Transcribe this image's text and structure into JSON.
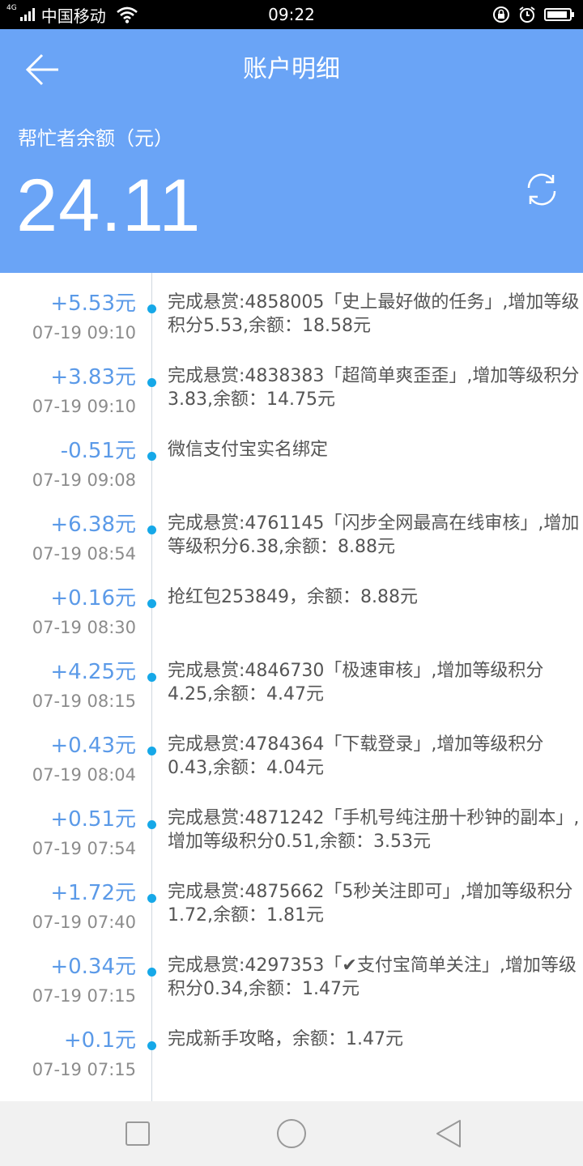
{
  "status_bar": {
    "network": "4G",
    "carrier": "中国移动",
    "time": "09:22",
    "icons": [
      "signal-icon",
      "wifi-icon",
      "rotation-lock-icon",
      "alarm-icon",
      "battery-icon"
    ]
  },
  "header": {
    "title": "账户明细",
    "balance_label": "帮忙者余额（元）",
    "balance": "24.11",
    "background_color": "#6aa4f6",
    "icons": [
      "back-arrow-icon",
      "refresh-icon"
    ]
  },
  "records": [
    {
      "amount": "+5.53元",
      "time": "07-19 09:10",
      "desc": "完成悬赏:4858005「史上最好做的任务」,增加等级积分5.53,余额：18.58元"
    },
    {
      "amount": "+3.83元",
      "time": "07-19 09:10",
      "desc": "完成悬赏:4838383「超简单爽歪歪」,增加等级积分3.83,余额：14.75元"
    },
    {
      "amount": "-0.51元",
      "time": "07-19 09:08",
      "desc": "微信支付宝实名绑定"
    },
    {
      "amount": "+6.38元",
      "time": "07-19 08:54",
      "desc": "完成悬赏:4761145「闪步全网最高在线审核」,增加等级积分6.38,余额：8.88元"
    },
    {
      "amount": "+0.16元",
      "time": "07-19 08:30",
      "desc": "抢红包253849，余额：8.88元"
    },
    {
      "amount": "+4.25元",
      "time": "07-19 08:15",
      "desc": "完成悬赏:4846730「极速审核」,增加等级积分4.25,余额：4.47元"
    },
    {
      "amount": "+0.43元",
      "time": "07-19 08:04",
      "desc": "完成悬赏:4784364「下载登录」,增加等级积分0.43,余额：4.04元"
    },
    {
      "amount": "+0.51元",
      "time": "07-19 07:54",
      "desc": "完成悬赏:4871242「手机号纯注册十秒钟的副本」,增加等级积分0.51,余额：3.53元"
    },
    {
      "amount": "+1.72元",
      "time": "07-19 07:40",
      "desc": "完成悬赏:4875662「5秒关注即可」,增加等级积分1.72,余额：1.81元"
    },
    {
      "amount": "+0.34元",
      "time": "07-19 07:15",
      "desc": "完成悬赏:4297353「✔支付宝简单关注」,增加等级积分0.34,余额：1.47元"
    },
    {
      "amount": "+0.1元",
      "time": "07-19 07:15",
      "desc": "完成新手攻略，余额：1.47元"
    }
  ],
  "colors": {
    "amount": "#5b9ae8",
    "timeline_dot": "#16a8e8"
  },
  "nav_bar": {
    "icons": [
      "recents-square-icon",
      "home-circle-icon",
      "back-triangle-icon"
    ]
  }
}
